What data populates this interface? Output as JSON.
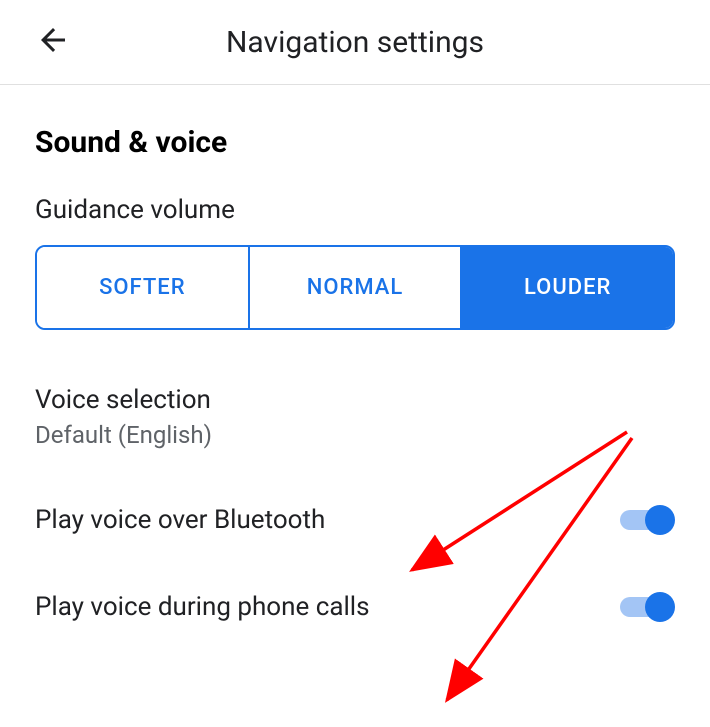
{
  "header": {
    "title": "Navigation settings"
  },
  "section": {
    "title": "Sound & voice"
  },
  "guidance": {
    "label": "Guidance volume",
    "options": {
      "softer": "SOFTER",
      "normal": "NORMAL",
      "louder": "LOUDER"
    },
    "selected": "louder"
  },
  "voice_selection": {
    "title": "Voice selection",
    "value": "Default (English)"
  },
  "toggles": {
    "bluetooth": {
      "label": "Play voice over Bluetooth",
      "on": true
    },
    "phone_calls": {
      "label": "Play voice during phone calls",
      "on": true
    }
  }
}
